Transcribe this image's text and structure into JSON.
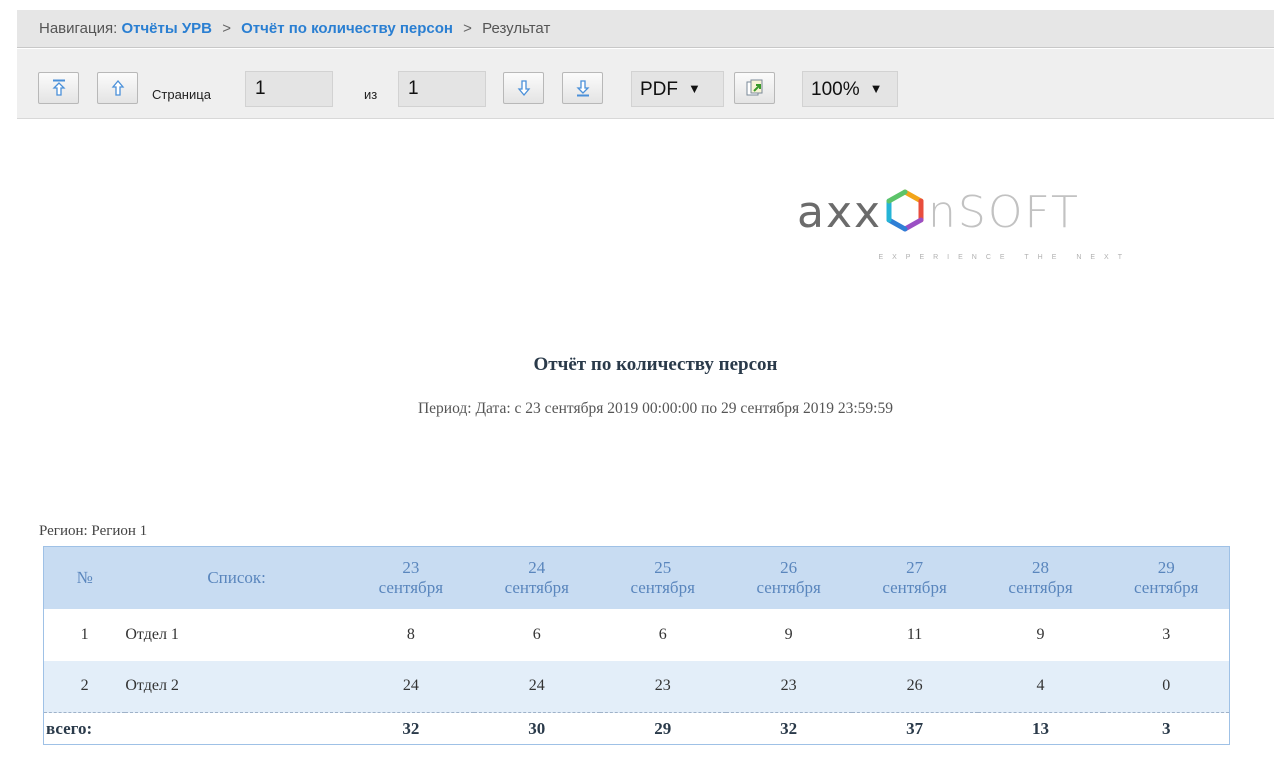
{
  "nav": {
    "label": "Навигация:",
    "crumbs": [
      "Отчёты УРВ",
      "Отчёт по количеству персон"
    ],
    "current": "Результат",
    "separator": ">"
  },
  "toolbar": {
    "page_label": "Страница",
    "page_value": "1",
    "of_label": "из",
    "total_pages": "1",
    "format": "PDF",
    "zoom": "100%"
  },
  "logo": {
    "text_main": "axx",
    "text_soft": "nSOFT",
    "tagline": "EXPERIENCE THE NEXT"
  },
  "report": {
    "title": "Отчёт по количеству персон",
    "period": "Период: Дата: с 23 сентября 2019 00:00:00 по 29 сентября 2019 23:59:59",
    "region": "Регион: Регион 1"
  },
  "table": {
    "col_num": "№",
    "col_list": "Список:",
    "days": [
      {
        "day": "23",
        "month": "сентября"
      },
      {
        "day": "24",
        "month": "сентября"
      },
      {
        "day": "25",
        "month": "сентября"
      },
      {
        "day": "26",
        "month": "сентября"
      },
      {
        "day": "27",
        "month": "сентября"
      },
      {
        "day": "28",
        "month": "сентября"
      },
      {
        "day": "29",
        "month": "сентября"
      }
    ],
    "rows": [
      {
        "num": "1",
        "name": "Отдел 1",
        "values": [
          "8",
          "6",
          "6",
          "9",
          "11",
          "9",
          "3"
        ]
      },
      {
        "num": "2",
        "name": "Отдел 2",
        "values": [
          "24",
          "24",
          "23",
          "23",
          "26",
          "4",
          "0"
        ]
      }
    ],
    "total_label": "всего:",
    "totals": [
      "32",
      "30",
      "29",
      "32",
      "37",
      "13",
      "3"
    ]
  },
  "colors": {
    "header_bg": "#c8dcf2",
    "header_text": "#5a86bd",
    "alt_row_bg": "#e3eef9",
    "link": "#2a7fd2"
  }
}
